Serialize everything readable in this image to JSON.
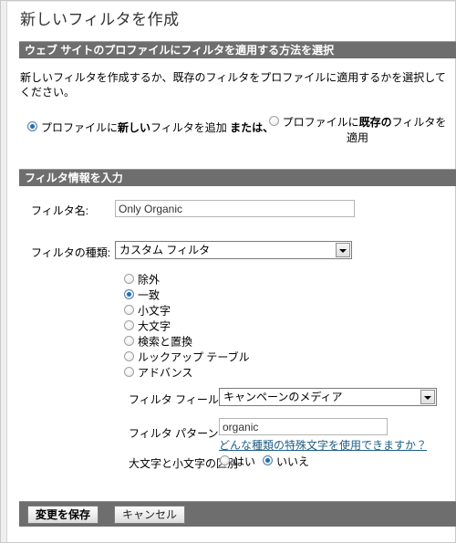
{
  "page": {
    "title": "新しいフィルタを作成"
  },
  "section_apply": {
    "header": "ウェブ サイトのプロファイルにフィルタを適用する方法を選択",
    "intro": "新しいフィルタを作成するか、既存のフィルタをプロファイルに適用するかを選択してください。",
    "option_new": {
      "prefix": "プロファイルに",
      "emphasis": "新しい",
      "suffix": "フィルタを追加 ",
      "conjunction": "または、",
      "selected": true
    },
    "option_existing": {
      "prefix": "プロファイルに",
      "emphasis": "既存の",
      "suffix": "フィルタを適用",
      "selected": false
    }
  },
  "section_info": {
    "header": "フィルタ情報を入力",
    "filter_name": {
      "label": "フィルタ名:",
      "value": "Only Organic"
    },
    "filter_type": {
      "label": "フィルタの種類:",
      "value": "カスタム フィルタ",
      "arrow_icon": "chevron-down-icon"
    },
    "custom_filter_options": [
      {
        "label": "除外",
        "selected": false
      },
      {
        "label": "一致",
        "selected": true
      },
      {
        "label": "小文字",
        "selected": false
      },
      {
        "label": "大文字",
        "selected": false
      },
      {
        "label": "検索と置換",
        "selected": false
      },
      {
        "label": "ルックアップ テーブル",
        "selected": false
      },
      {
        "label": "アドバンス",
        "selected": false
      }
    ],
    "filter_field": {
      "label": "フィルタ フィールド",
      "value": "キャンペーンのメディア",
      "arrow_icon": "chevron-down-icon"
    },
    "filter_pattern": {
      "label": "フィルタ パターン",
      "value": "organic",
      "help_link": "どんな種類の特殊文字を使用できますか？"
    },
    "case_sensitive": {
      "label": "大文字と小文字の区別",
      "options": [
        {
          "label": "はい",
          "selected": false
        },
        {
          "label": "いいえ",
          "selected": true
        }
      ]
    }
  },
  "footer": {
    "save_label": "変更を保存",
    "cancel_label": "キャンセル"
  },
  "colors": {
    "section_bar": "#6e6e6e",
    "link": "#1d5f85",
    "radio_accent": "#1f6fb5",
    "title_text": "#333333"
  }
}
